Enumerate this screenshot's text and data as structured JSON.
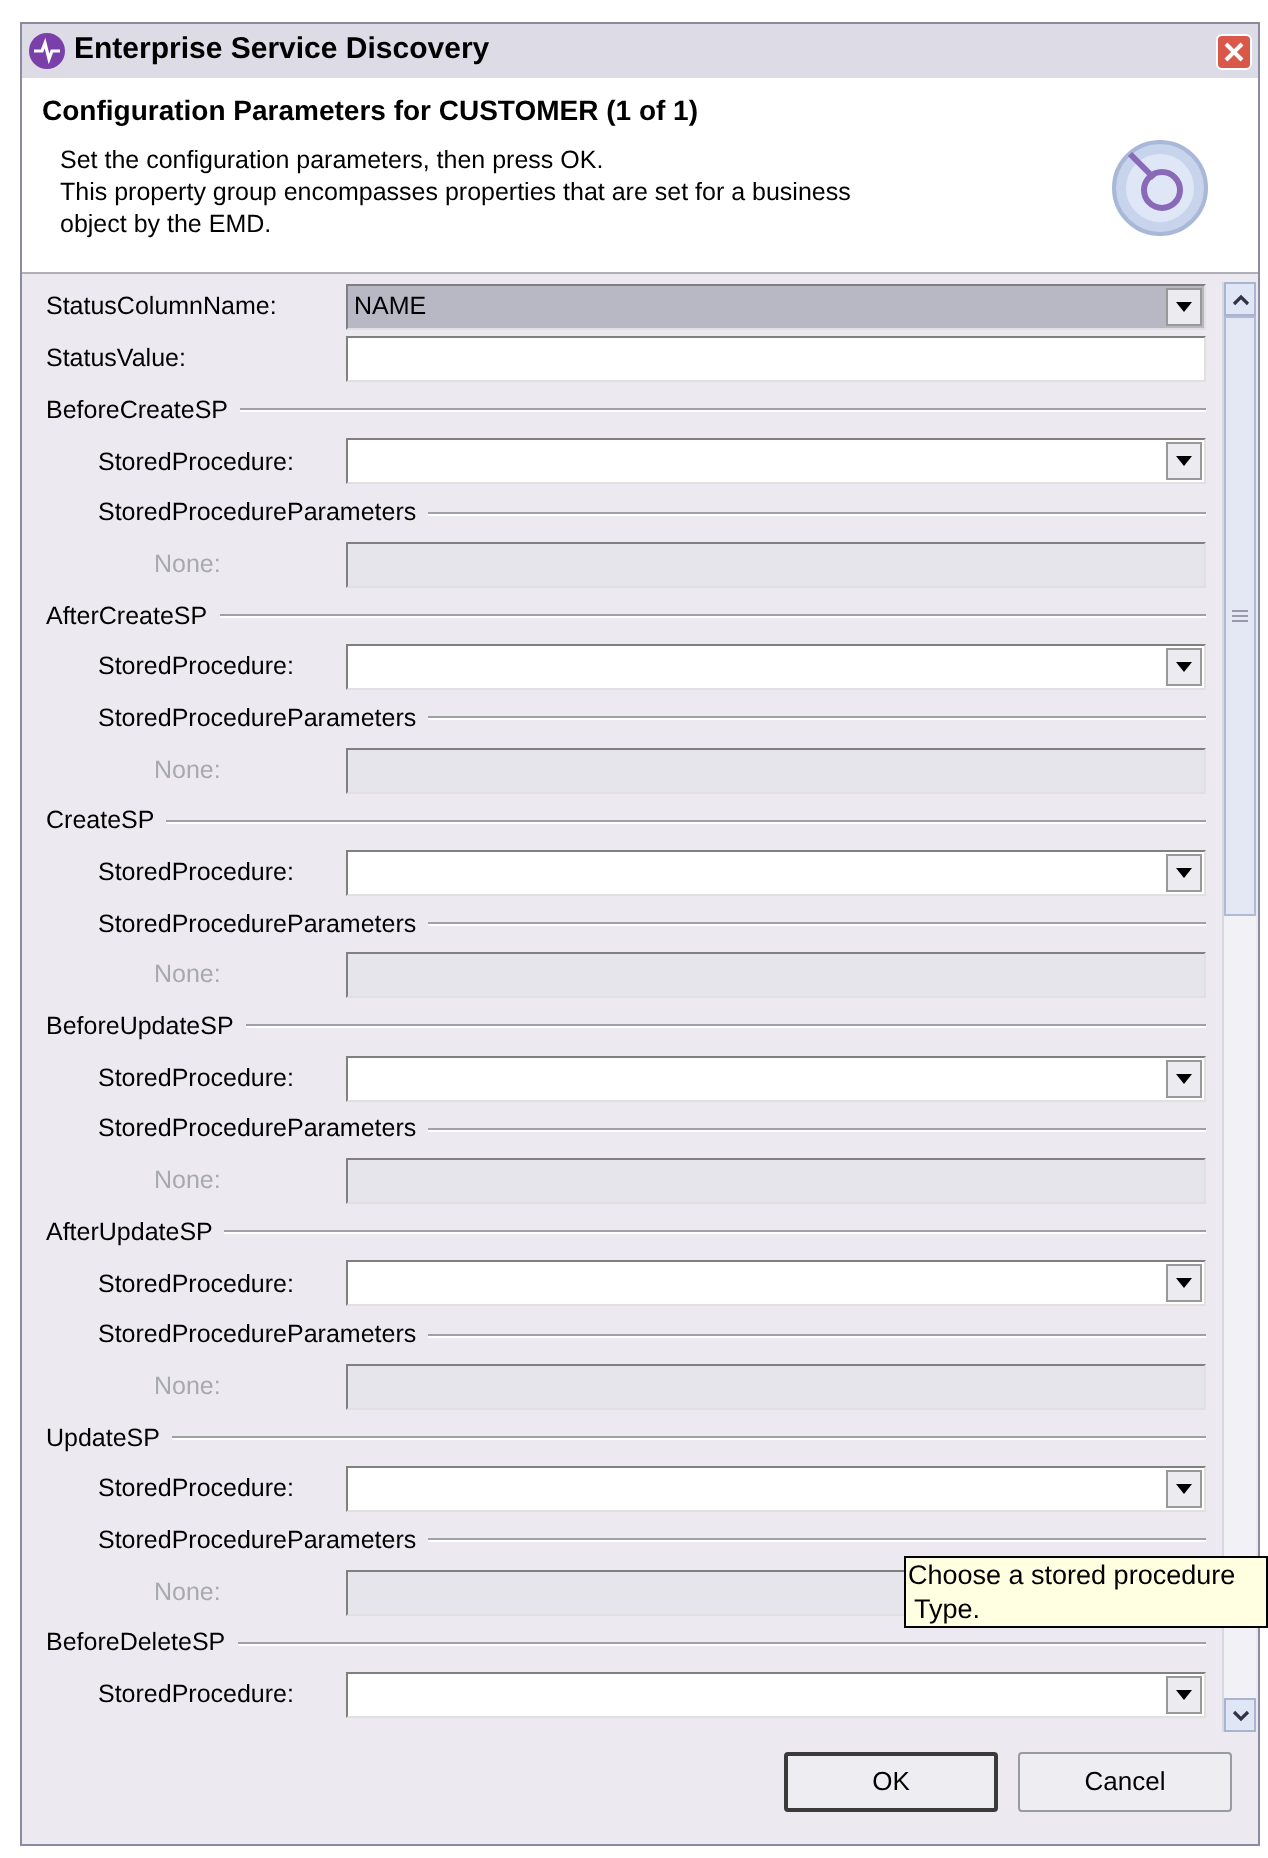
{
  "window": {
    "title": "Enterprise Service Discovery"
  },
  "header": {
    "title": "Configuration Parameters for CUSTOMER (1 of 1)",
    "description": [
      "Set the configuration parameters, then press OK.",
      "This property group encompasses properties that are set for a business",
      "object by the EMD."
    ]
  },
  "fields": [
    {
      "label": "StatusColumnName:",
      "kind": "combo",
      "value": "NAME",
      "highlighted": true
    },
    {
      "label": "StatusValue:",
      "kind": "text",
      "highlighted": false
    }
  ],
  "groups": [
    {
      "title": "BeforeCreateSP",
      "stored_procedure": {
        "label": "StoredProcedure:"
      },
      "parameters": {
        "title": "StoredProcedureParameters",
        "label": "None:",
        "disabled": true
      }
    },
    {
      "title": "AfterCreateSP",
      "stored_procedure": {
        "label": "StoredProcedure:"
      },
      "parameters": {
        "title": "StoredProcedureParameters",
        "label": "None:",
        "disabled": true
      }
    },
    {
      "title": "CreateSP",
      "stored_procedure": {
        "label": "StoredProcedure:"
      },
      "parameters": {
        "title": "StoredProcedureParameters",
        "label": "None:",
        "disabled": true
      }
    },
    {
      "title": "BeforeUpdateSP",
      "stored_procedure": {
        "label": "StoredProcedure:"
      },
      "parameters": {
        "title": "StoredProcedureParameters",
        "label": "None:",
        "disabled": true
      }
    },
    {
      "title": "AfterUpdateSP",
      "stored_procedure": {
        "label": "StoredProcedure:"
      },
      "parameters": {
        "title": "StoredProcedureParameters",
        "label": "None:",
        "disabled": true
      }
    },
    {
      "title": "UpdateSP",
      "stored_procedure": {
        "label": "StoredProcedure:"
      },
      "parameters": {
        "title": "StoredProcedureParameters",
        "label": "None:",
        "disabled": true
      }
    },
    {
      "title": "BeforeDeleteSP",
      "stored_procedure": {
        "label": "StoredProcedure:"
      }
    }
  ],
  "tooltip": {
    "lines": [
      "Choose a stored procedure",
      "Type."
    ]
  },
  "buttons": [
    {
      "label": "OK",
      "default": true
    },
    {
      "label": "Cancel",
      "default": false
    }
  ]
}
